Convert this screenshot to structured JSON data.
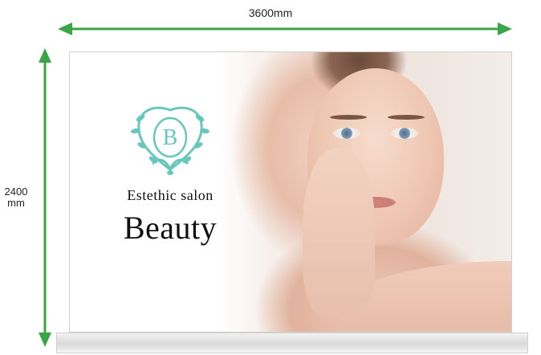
{
  "dimensions": {
    "width_label": "3600mm",
    "height_line1": "2400",
    "height_line2": "mm",
    "arrow_color": "#3aa546"
  },
  "sign": {
    "logo_letter": "B",
    "subtitle": "Estethic salon",
    "title": "Beauty",
    "logo_color": "#67c7bd"
  }
}
